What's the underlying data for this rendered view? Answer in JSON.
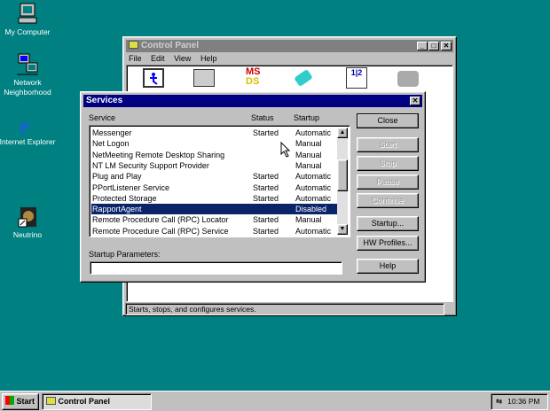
{
  "desktop": {
    "icons": [
      {
        "label": "My Computer",
        "icon": "computer-icon"
      },
      {
        "label": "Network Neighborhood",
        "icon": "network-icon"
      },
      {
        "label": "Internet Explorer",
        "icon": "ie-icon"
      },
      {
        "label": "Neutrino",
        "icon": "neutrino-shortcut-icon"
      }
    ]
  },
  "control_panel": {
    "title": "Control Panel",
    "menu": [
      "File",
      "Edit",
      "View",
      "Help"
    ],
    "status": "Starts, stops, and configures services."
  },
  "services": {
    "title": "Services",
    "columns": [
      "Service",
      "Status",
      "Startup"
    ],
    "rows": [
      {
        "name": "Messenger",
        "status": "Started",
        "startup": "Automatic"
      },
      {
        "name": "Net Logon",
        "status": "",
        "startup": "Manual"
      },
      {
        "name": "NetMeeting Remote Desktop Sharing",
        "status": "",
        "startup": "Manual"
      },
      {
        "name": "NT LM Security Support Provider",
        "status": "",
        "startup": "Manual"
      },
      {
        "name": "Plug and Play",
        "status": "Started",
        "startup": "Automatic"
      },
      {
        "name": "PPortListener Service",
        "status": "Started",
        "startup": "Automatic"
      },
      {
        "name": "Protected Storage",
        "status": "Started",
        "startup": "Automatic"
      },
      {
        "name": "RapportAgent",
        "status": "",
        "startup": "Disabled",
        "selected": true
      },
      {
        "name": "Remote Procedure Call (RPC) Locator",
        "status": "Started",
        "startup": "Manual"
      },
      {
        "name": "Remote Procedure Call (RPC) Service",
        "status": "Started",
        "startup": "Automatic"
      }
    ],
    "buttons": {
      "close": "Close",
      "start": "Start",
      "stop": "Stop",
      "pause": "Pause",
      "continue": "Continue",
      "startup": "Startup...",
      "hw_profiles": "HW Profiles...",
      "help": "Help"
    },
    "startup_params_label": "Startup Parameters:",
    "startup_params_value": ""
  },
  "taskbar": {
    "start": "Start",
    "task": "Control Panel",
    "clock": "10:36 PM"
  },
  "colors": {
    "desktop": "#008080",
    "titlebar": "#000080",
    "selection": "#0a246a"
  }
}
